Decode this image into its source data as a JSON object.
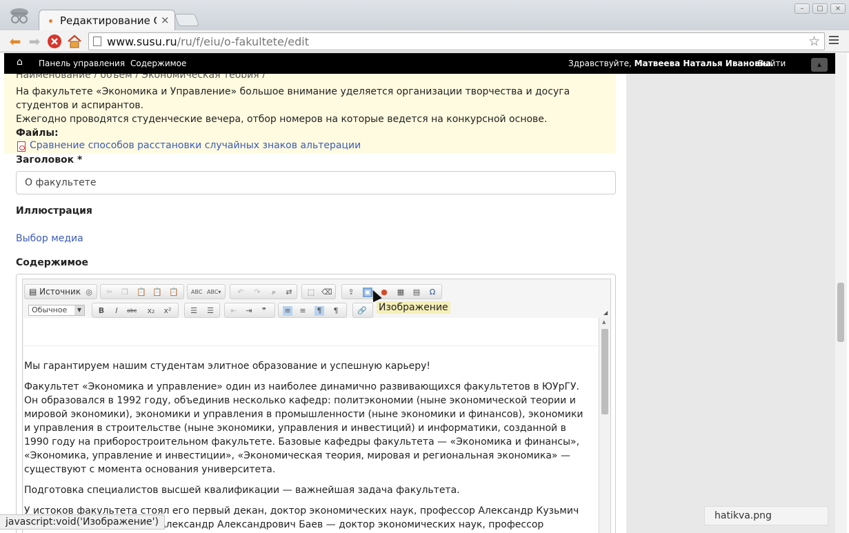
{
  "browser": {
    "tab_title": "Редактирование О ф",
    "tab_close": "×",
    "url_host": "www.susu.ru",
    "url_path": "/ru/f/eiu/o-fakultete/edit",
    "status_text": "javascript:void('Изображение')",
    "download_name": "hatikva.png"
  },
  "adminbar": {
    "dashboard": "Панель управления",
    "content": "Содержимое",
    "greeting": "Здравствуйте,",
    "user_name": "Матвеева Наталья Ивановна",
    "dot": ".",
    "logout": "Выйти"
  },
  "notice": {
    "cut_line": "Наименование / объем / Экономическая теория /",
    "line1": "На факультете «Экономика и Управление» большое внимание уделяется организации творчества и досуга студентов и аспирантов.",
    "line2": "Ежегодно проводятся студенческие вечера, отбор номеров на которые ведется на конкурсной основе.",
    "files_label": "Файлы:",
    "file_link": "Сравнение способов расстановки случайных знаков альтерации"
  },
  "form": {
    "title_label": "Заголовок *",
    "title_value": "О факультете",
    "illustration_label": "Иллюстрация",
    "media_link": "Выбор медиа",
    "content_label": "Содержимое"
  },
  "editor": {
    "source_label": "Источник",
    "format_value": "Обычное",
    "tooltip": "Изображение",
    "p1": "Мы гарантируем нашим студентам элитное образование и успешную карьеру!",
    "p2": "Факультет «Экономика и управление» один из наиболее динамично развивающихся факультетов в ЮУрГУ. Он образовался в 1992 году, объединив несколько кафедр: политэкономии (ныне экономической теории и мировой экономики), экономики и управления в промышленности (ныне экономики и финансов), экономики и управления в строительстве (ныне экономики, управления и инвестиций) и информатики, созданной в 1990 году на приборостроительном факультете. Базовые кафедры факультета — «Экономика и финансы», «Экономика, управление и инвестиции», «Экономическая теория, мировая и региональная экономика» — существуют с момента основания университета.",
    "p3": "Подготовка специалистов высшей квалификации — важнейшая задача факультета.",
    "p4": "У истоков факультета стоял его первый декан, доктор экономических наук, профессор Александр Кузьмич Тащев.",
    "p5": "Сейчас деканом является Александр Александрович Баев — доктор экономических наук, профессор"
  }
}
